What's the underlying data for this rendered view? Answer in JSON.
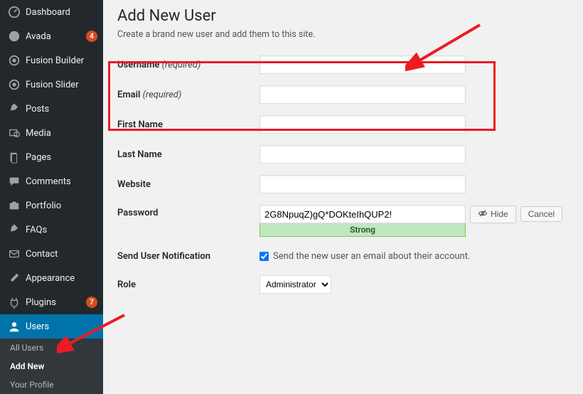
{
  "sidebar": {
    "items": [
      {
        "label": "Dashboard",
        "icon": "dashboard"
      },
      {
        "label": "Avada",
        "icon": "avada",
        "badge": "4"
      },
      {
        "label": "Fusion Builder",
        "icon": "fusion"
      },
      {
        "label": "Fusion Slider",
        "icon": "fusion"
      }
    ],
    "items2": [
      {
        "label": "Posts",
        "icon": "pin"
      },
      {
        "label": "Media",
        "icon": "media"
      },
      {
        "label": "Pages",
        "icon": "page"
      },
      {
        "label": "Comments",
        "icon": "comment"
      },
      {
        "label": "Portfolio",
        "icon": "portfolio"
      },
      {
        "label": "FAQs",
        "icon": "pin"
      },
      {
        "label": "Contact",
        "icon": "contact"
      }
    ],
    "items3": [
      {
        "label": "Appearance",
        "icon": "brush"
      },
      {
        "label": "Plugins",
        "icon": "plugin",
        "badge": "7"
      },
      {
        "label": "Users",
        "icon": "users",
        "active": true
      }
    ],
    "submenu": [
      {
        "label": "All Users"
      },
      {
        "label": "Add New",
        "current": true
      },
      {
        "label": "Your Profile"
      }
    ]
  },
  "page": {
    "title": "Add New User",
    "desc": "Create a brand new user and add them to this site."
  },
  "form": {
    "username_label": "Username",
    "email_label": "Email",
    "required": "(required)",
    "firstname_label": "First Name",
    "lastname_label": "Last Name",
    "website_label": "Website",
    "password_label": "Password",
    "password_value": "2G8NpuqZ)gQ*DOKteIhQUP2!",
    "password_strength": "Strong",
    "hide_btn": "Hide",
    "cancel_btn": "Cancel",
    "notify_label": "Send User Notification",
    "notify_text": "Send the new user an email about their account.",
    "notify_checked": true,
    "role_label": "Role",
    "role_value": "Administrator"
  }
}
